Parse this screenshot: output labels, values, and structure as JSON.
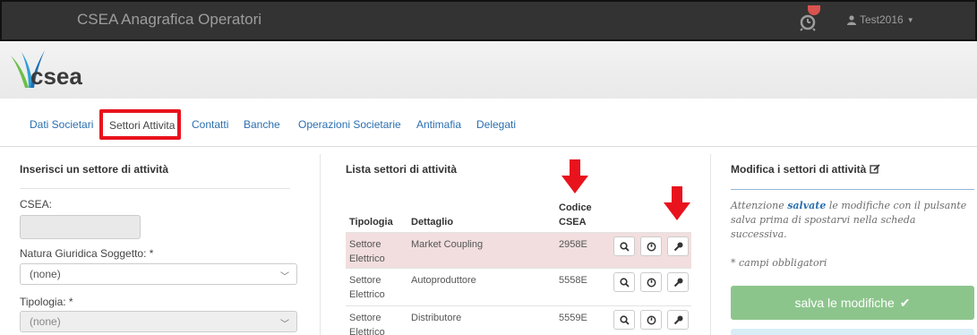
{
  "navbar": {
    "title": "CSEA Anagrafica Operatori",
    "alarm_icon": "alarm-clock-icon",
    "user_icon": "user-icon",
    "user_name": "Test2016"
  },
  "logo": {
    "text": "csea"
  },
  "tabs": [
    {
      "label": "Dati Societari"
    },
    {
      "label": "Settori Attivita"
    },
    {
      "label": "Contatti"
    },
    {
      "label": "Banche"
    },
    {
      "label": "Operazioni Societarie"
    },
    {
      "label": "Antimafia"
    },
    {
      "label": "Delegati"
    }
  ],
  "form": {
    "title": "Inserisci un settore di attività",
    "csea_label": "CSEA:",
    "csea_value": "",
    "natura_label": "Natura Giuridica Soggetto: *",
    "natura_value": "(none)",
    "tipologia_label": "Tipologia: *",
    "tipologia_value": "(none)"
  },
  "list": {
    "title": "Lista settori di attività",
    "headers": {
      "tipologia": "Tipologia",
      "dettaglio": "Dettaglio",
      "codice_line1": "Codice",
      "codice_line2": "CSEA"
    },
    "rows": [
      {
        "tipologia": "Settore Elettrico",
        "dettaglio": "Market Coupling",
        "codice": "2958E"
      },
      {
        "tipologia": "Settore Elettrico",
        "dettaglio": "Autoproduttore",
        "codice": "5558E"
      },
      {
        "tipologia": "Settore Elettrico",
        "dettaglio": "Distributore",
        "codice": "5559E"
      }
    ],
    "action_icons": [
      "search-icon",
      "power-icon",
      "wrench-icon"
    ]
  },
  "edit": {
    "title": "Modifica i settori di attività",
    "note_before": "Attenzione ",
    "note_emphasis": "salvate",
    "note_after": " le modifiche con il pulsante salva prima di spostarvi nella scheda successiva.",
    "required_note": "* campi obbligatori",
    "save_label": "salva le modifiche"
  },
  "colors": {
    "navbar": "#333333",
    "highlight_red": "#e8131d",
    "link_blue": "#2a6fb0",
    "save_green": "#8cc58c",
    "row_highlight": "#f2dede"
  }
}
